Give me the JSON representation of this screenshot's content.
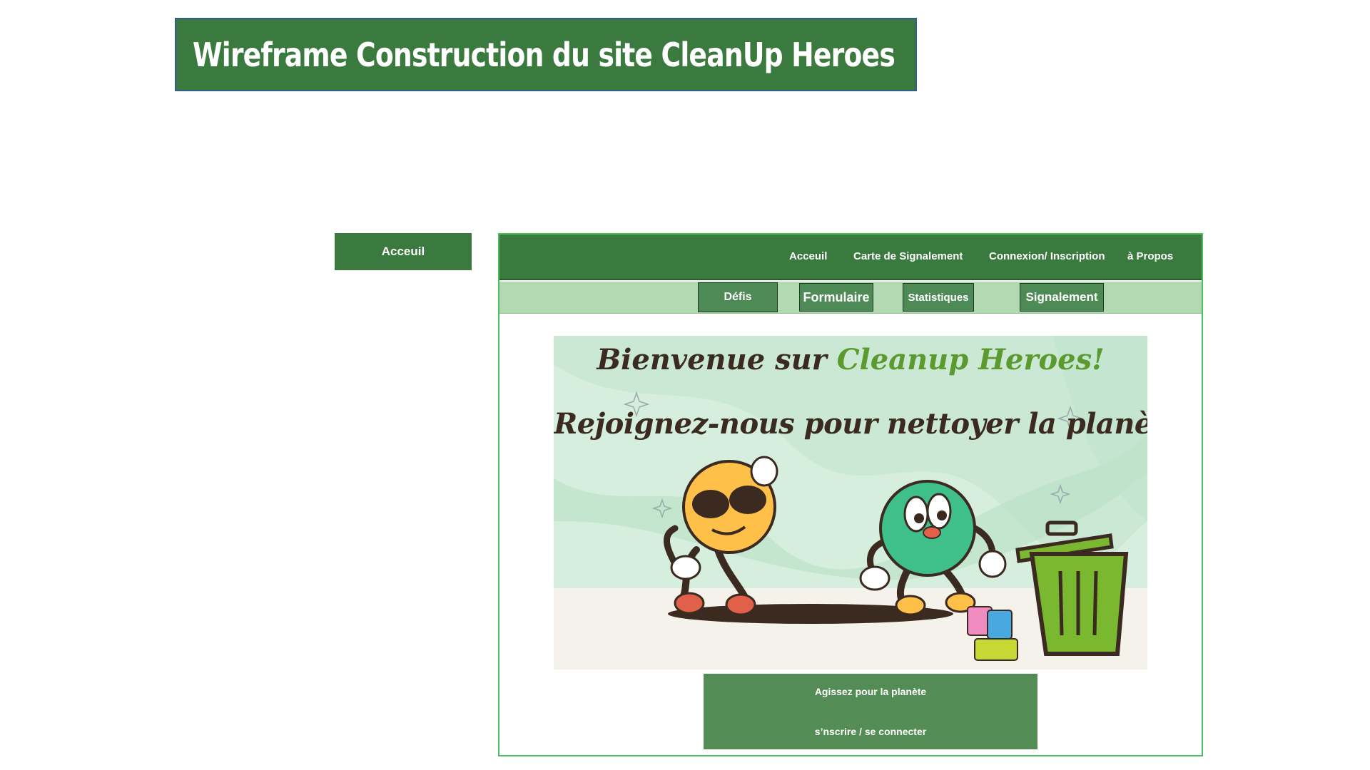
{
  "title": "Wireframe Construction du site CleanUp Heroes",
  "page_label": "Acceuil",
  "nav": {
    "items": [
      {
        "label": "Acceuil"
      },
      {
        "label": "Carte de  Signalement"
      },
      {
        "label": "Connexion/ Inscription"
      },
      {
        "label": "à Propos"
      }
    ]
  },
  "subnav": {
    "buttons": [
      {
        "label": "Défis"
      },
      {
        "label": "Formulaire"
      },
      {
        "label": "Statistiques"
      },
      {
        "label": "Signalement"
      }
    ]
  },
  "hero": {
    "line1_prefix": "Bienvenue sur ",
    "line1_brand": "Cleanup Heroes!",
    "line2": "Rejoignez-nous pour nettoyer la planète,"
  },
  "cta": {
    "line1": "Agissez pour la  planète",
    "link": "s’nscrire / se connecter"
  },
  "colors": {
    "primary_green": "#3a7a3e",
    "light_green": "#b2d9b2",
    "button_green": "#4e8a55",
    "hero_bg": "#d6eedd",
    "brand_text": "#5a9a2e"
  }
}
